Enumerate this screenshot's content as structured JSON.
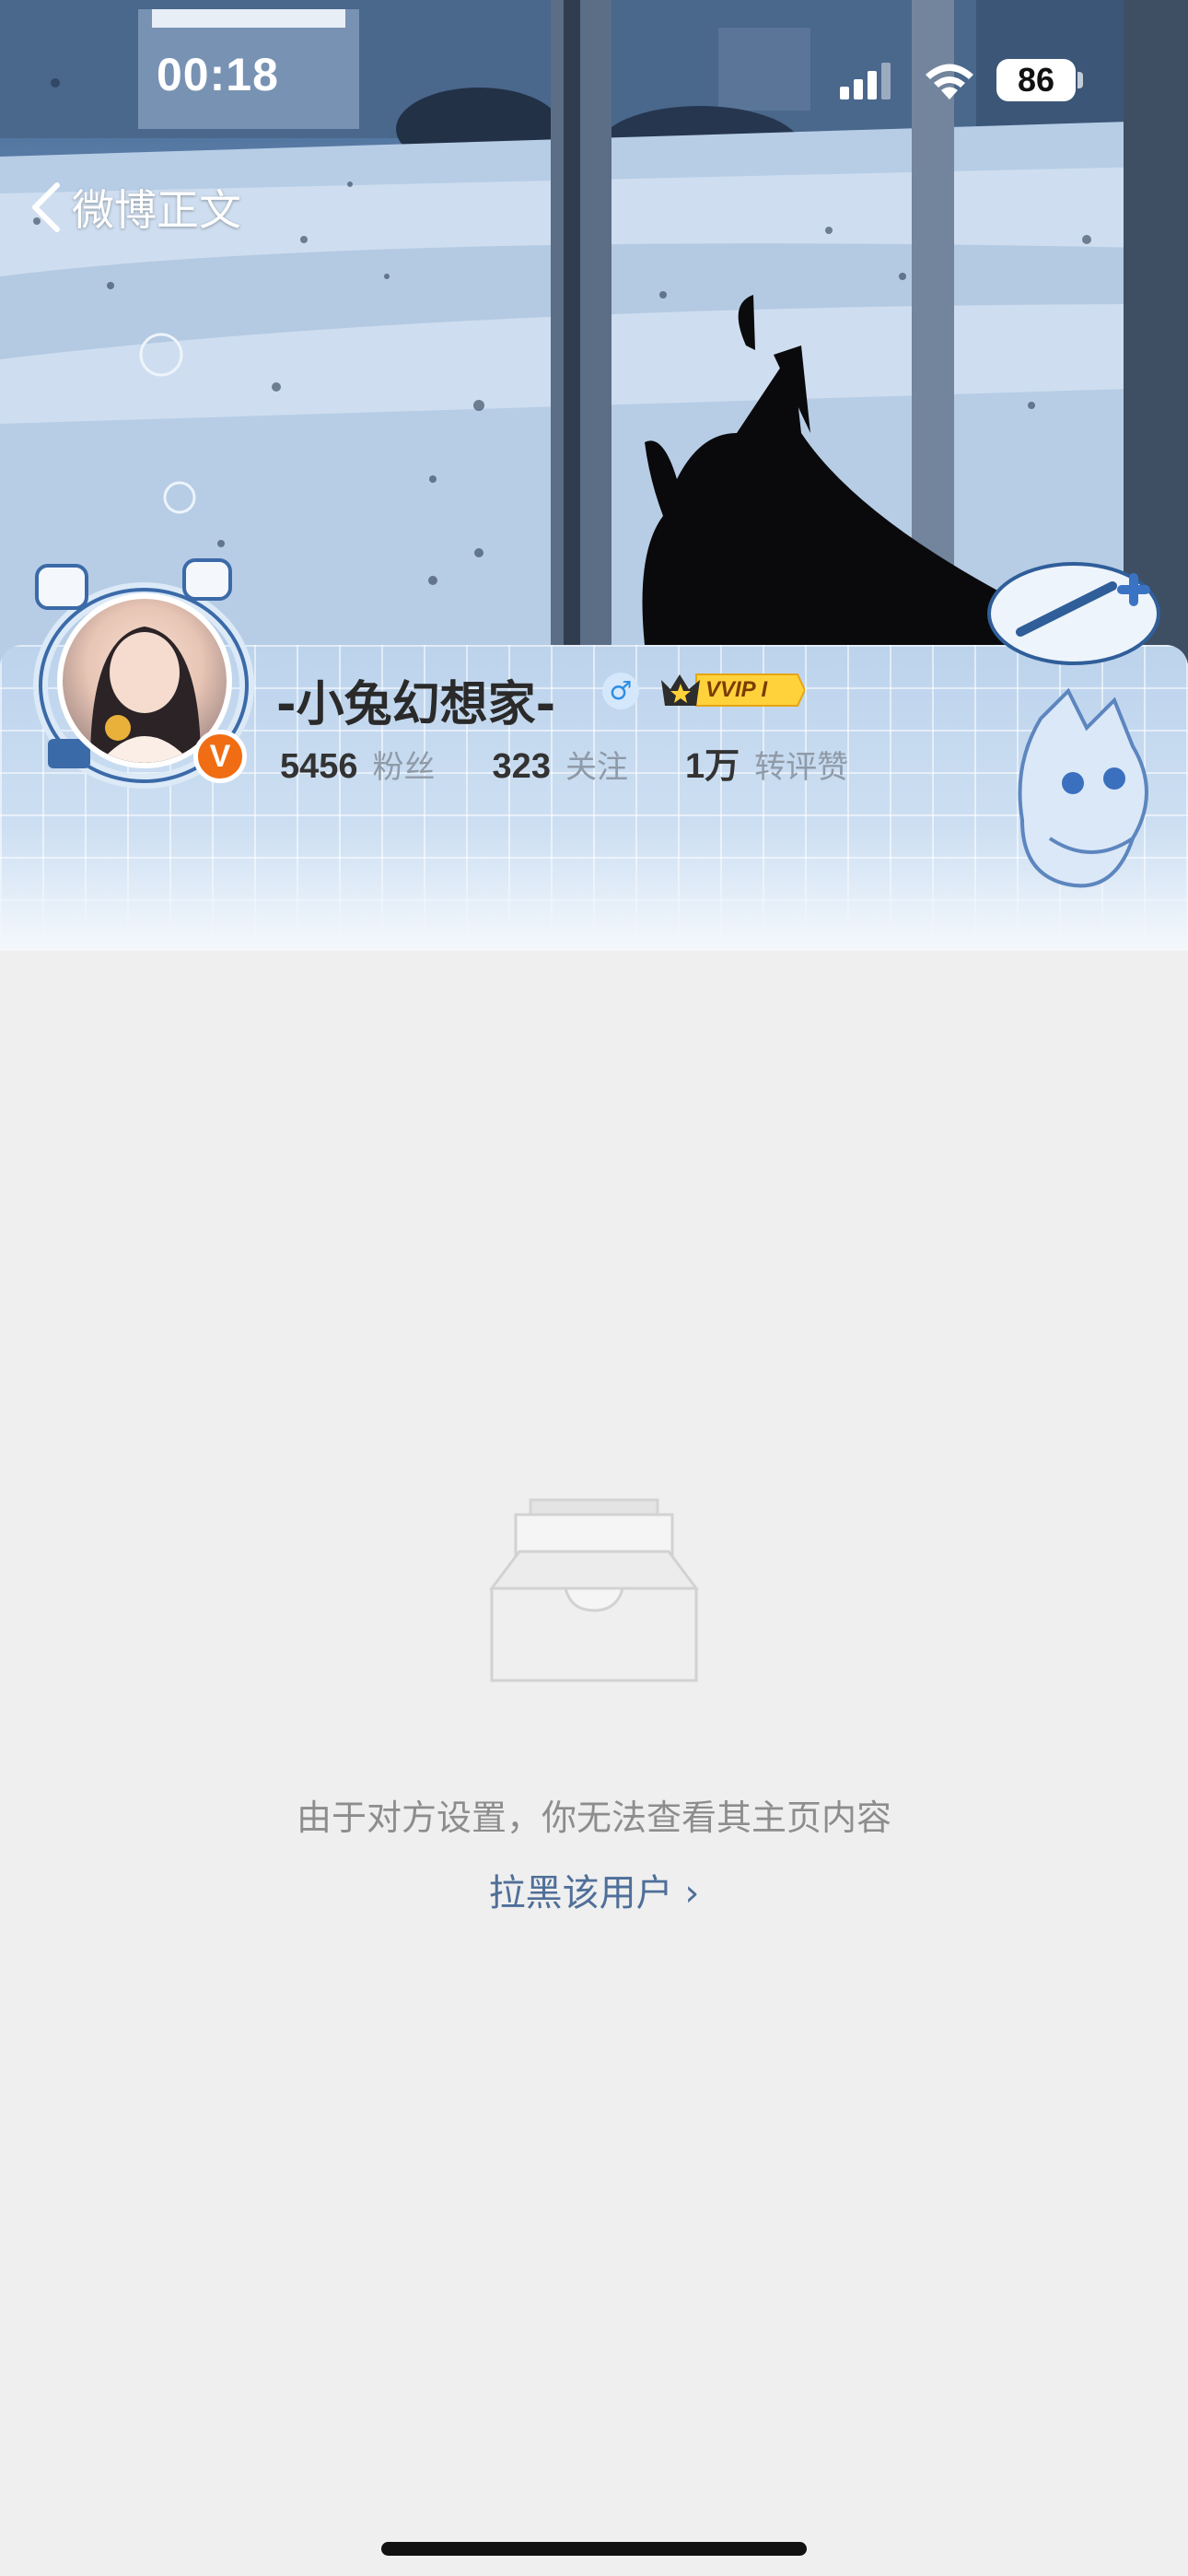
{
  "status_bar": {
    "time": "00:18",
    "battery": "86",
    "signal_icon": "cellular-signal-icon",
    "wifi_icon": "wifi-icon"
  },
  "nav": {
    "back_label": "微博正文",
    "back_icon": "chevron-left-icon"
  },
  "profile": {
    "username": "-小兔幻想家-",
    "gender_symbol": "♂",
    "vip_label": "VVIP I",
    "verified_badge": "V",
    "stats": [
      {
        "value": "5456",
        "label": "粉丝"
      },
      {
        "value": "323",
        "label": "关注"
      },
      {
        "value": "1万",
        "label": "转评赞"
      }
    ]
  },
  "empty_state": {
    "icon": "empty-box-icon",
    "message": "由于对方设置，你无法查看其主页内容",
    "block_link": "拉黑该用户 ›"
  },
  "colors": {
    "accent_link": "#4f6f99",
    "verified_orange": "#f06d14",
    "page_bg": "#efefef"
  }
}
